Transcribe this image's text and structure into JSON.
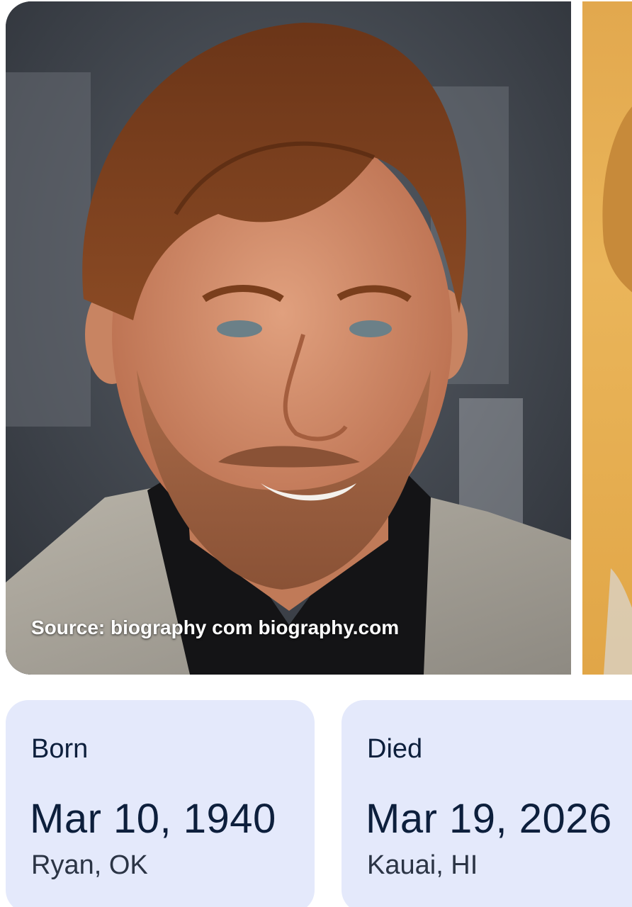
{
  "photo": {
    "subject": "portrait of smiling man with reddish-brown hair and beard, grey pinstripe jacket, black shirt",
    "source_caption": "Source: biography com biography.com"
  },
  "facts": {
    "born": {
      "label": "Born",
      "date": "Mar 10, 1940",
      "place": "Ryan, OK"
    },
    "died": {
      "label": "Died",
      "date": "Mar 19, 2026",
      "place": "Kauai, HI"
    }
  },
  "colors": {
    "card_background": "#e4e9fb",
    "text_primary": "#0d1f3c",
    "next_photo_background": "#e6ae52"
  }
}
